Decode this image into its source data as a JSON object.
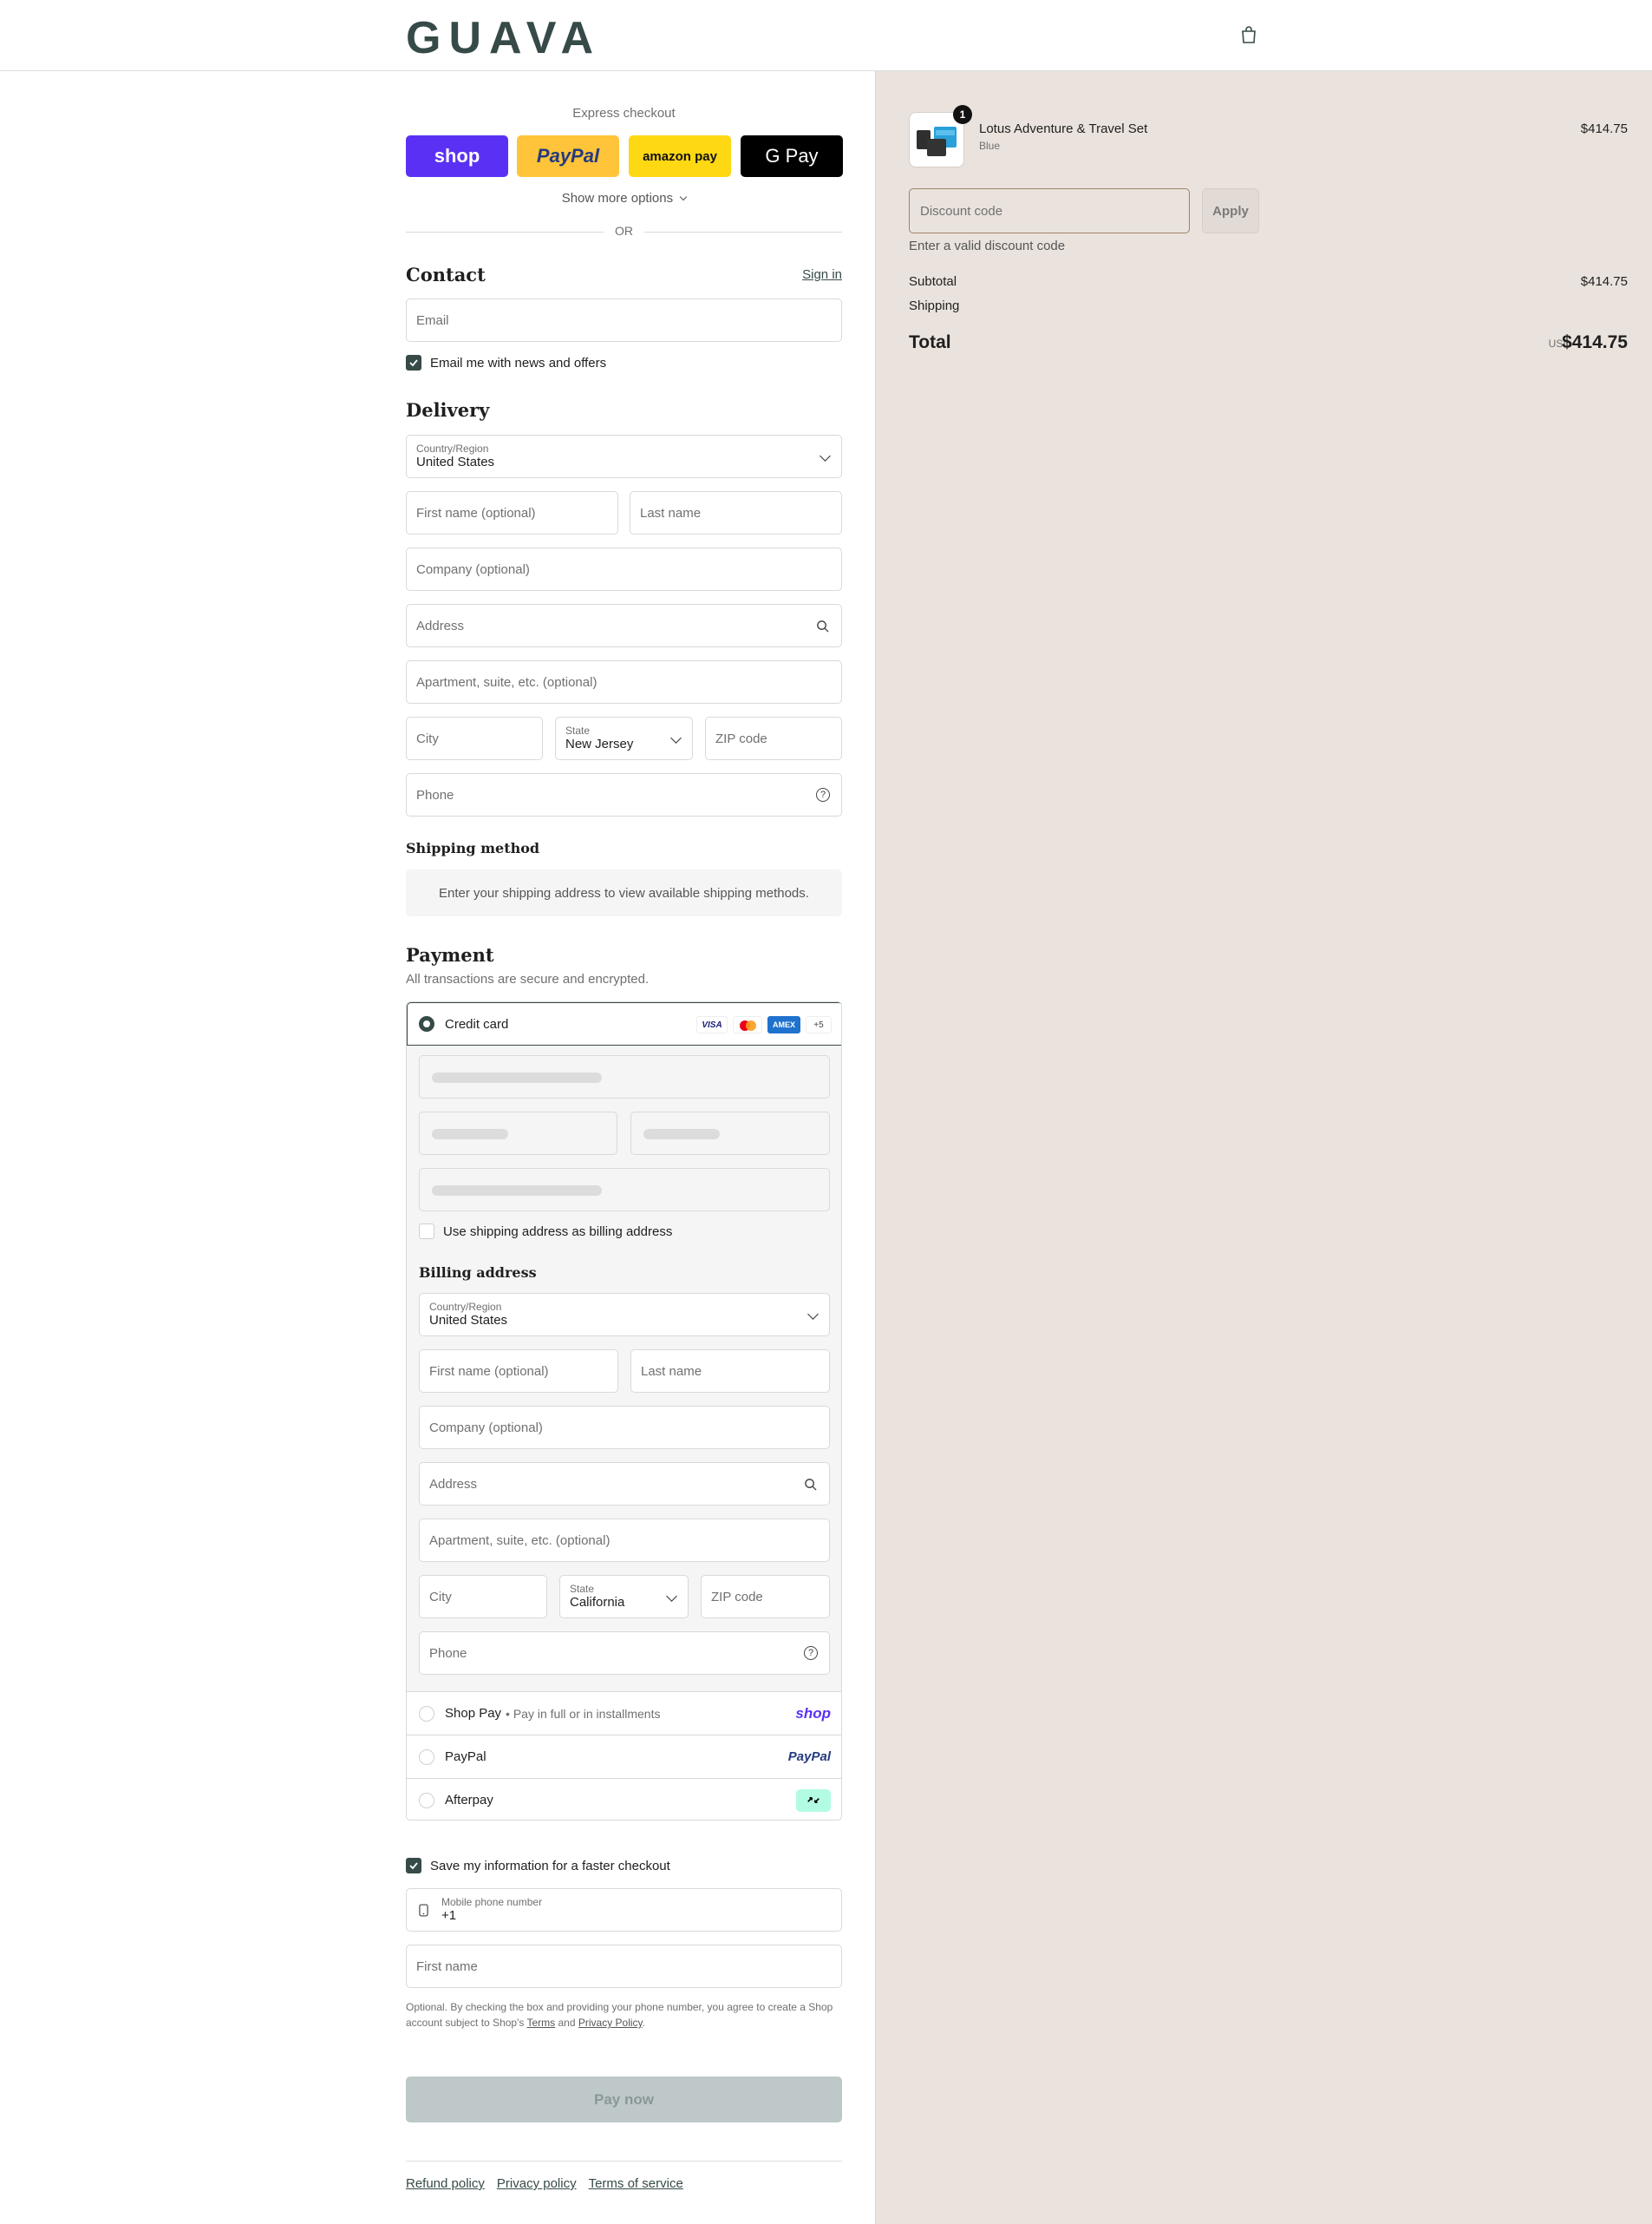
{
  "header": {
    "logo": "GUAVA",
    "cart_icon": "bag-icon"
  },
  "express": {
    "title": "Express checkout",
    "buttons": [
      "shop",
      "PayPal",
      "amazon pay",
      "G Pay"
    ],
    "show_more": "Show more options",
    "or": "OR"
  },
  "contact": {
    "title": "Contact",
    "sign_in": "Sign in",
    "email_placeholder": "Email",
    "news_label": "Email me with news and offers"
  },
  "delivery": {
    "title": "Delivery",
    "country_label": "Country/Region",
    "country_value": "United States",
    "first_name": "First name (optional)",
    "last_name": "Last name",
    "company": "Company (optional)",
    "address": "Address",
    "apartment": "Apartment, suite, etc. (optional)",
    "city": "City",
    "state_label": "State",
    "state_value": "New Jersey",
    "zip": "ZIP code",
    "phone": "Phone"
  },
  "shipping": {
    "title": "Shipping method",
    "message": "Enter your shipping address to view available shipping methods."
  },
  "payment": {
    "title": "Payment",
    "subtitle": "All transactions are secure and encrypted.",
    "credit_card": "Credit card",
    "card_more": "+5",
    "use_shipping": "Use shipping address as billing address",
    "billing": {
      "title": "Billing address",
      "country_label": "Country/Region",
      "country_value": "United States",
      "first_name": "First name (optional)",
      "last_name": "Last name",
      "company": "Company (optional)",
      "address": "Address",
      "apartment": "Apartment, suite, etc. (optional)",
      "city": "City",
      "state_label": "State",
      "state_value": "California",
      "zip": "ZIP code",
      "phone": "Phone"
    },
    "shop_pay": "Shop Pay",
    "shop_pay_sub": "• Pay in full or in installments",
    "shop_logo": "shop",
    "paypal": "PayPal",
    "paypal_logo": "PayPal",
    "afterpay": "Afterpay"
  },
  "save": {
    "label": "Save my information for a faster checkout",
    "mobile_label": "Mobile phone number",
    "mobile_value": "+1",
    "first_name": "First name",
    "legal_pre": "Optional. By checking the box and providing your phone number, you agree to create a Shop account subject to Shop's ",
    "terms": "Terms",
    "and": " and ",
    "privacy": "Privacy Policy",
    "period": "."
  },
  "pay_now": "Pay now",
  "footer": {
    "refund": "Refund policy",
    "privacy": "Privacy policy",
    "terms": "Terms of service"
  },
  "summary": {
    "item_name": "Lotus Adventure & Travel Set",
    "item_variant": "Blue",
    "item_price": "$414.75",
    "quantity": "1",
    "discount_placeholder": "Discount code",
    "apply": "Apply",
    "discount_error": "Enter a valid discount code",
    "subtotal_label": "Subtotal",
    "subtotal_value": "$414.75",
    "shipping_label": "Shipping",
    "total_label": "Total",
    "currency": "USD",
    "total_value": "$414.75"
  },
  "colors": {
    "accent": "#364a48",
    "side_bg": "#eae3dd",
    "shop_purple": "#5a31f4",
    "paypal_yellow": "#ffc439",
    "amazon_yellow": "#ffd814",
    "afterpay_mint": "#b2fce4"
  }
}
